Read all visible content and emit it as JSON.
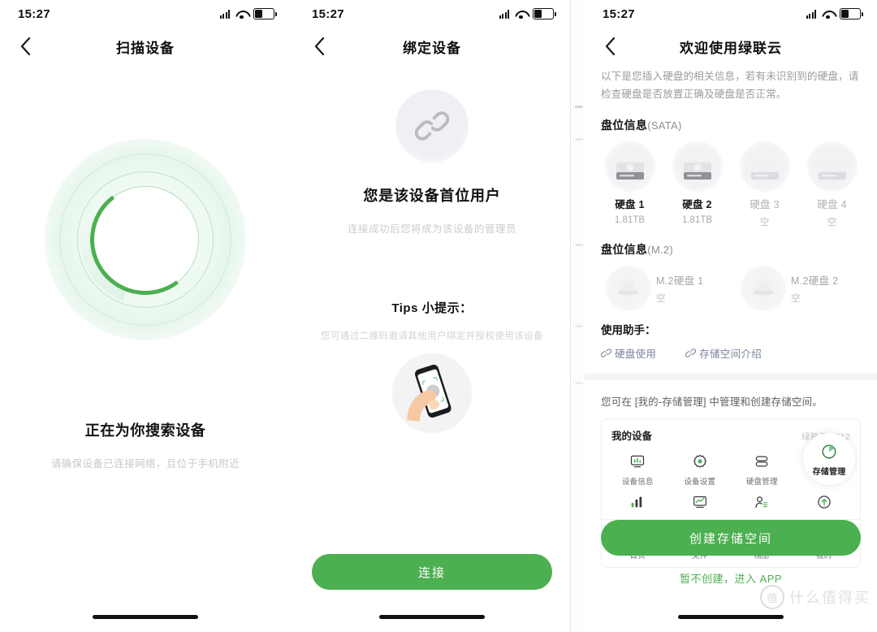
{
  "status_bar": {
    "time": "15:27"
  },
  "panel_scan": {
    "nav_title": "扫描设备",
    "title": "正在为你搜索设备",
    "subtitle": "请确保设备已连接网络，且位于手机附近"
  },
  "panel_bind": {
    "nav_title": "绑定设备",
    "title": "您是该设备首位用户",
    "subtitle": "连接成功后您将成为该设备的管理员",
    "tips_title": "Tips 小提示：",
    "tips_text": "您可通过二维码邀请其他用户绑定并授权使用该设备",
    "connect_button": "连接"
  },
  "panel_welcome": {
    "nav_title": "欢迎使用绿联云",
    "description": "以下是您插入硬盘的相关信息，若有未识别到的硬盘，请检查硬盘是否放置正确及硬盘是否正常。",
    "sata_section": {
      "label": "盘位信息",
      "suffix": "(SATA)"
    },
    "sata_bays": [
      {
        "name": "硬盘 1",
        "capacity": "1.81TB",
        "present": true
      },
      {
        "name": "硬盘 2",
        "capacity": "1.81TB",
        "present": true
      },
      {
        "name": "硬盘 3",
        "capacity": "空",
        "present": false
      },
      {
        "name": "硬盘 4",
        "capacity": "空",
        "present": false
      }
    ],
    "m2_section": {
      "label": "盘位信息",
      "suffix": "(M.2)"
    },
    "m2_bays": [
      {
        "name": "M.2硬盘 1",
        "capacity": "空"
      },
      {
        "name": "M.2硬盘 2",
        "capacity": "空"
      }
    ],
    "helper_title": "使用助手：",
    "helper_links": [
      {
        "label": "硬盘使用"
      },
      {
        "label": "存储空间介绍"
      }
    ],
    "note": "您可在 [我的-存储管理] 中管理和创建存储空间。",
    "preview": {
      "title": "我的设备",
      "model": "绿联云-4912",
      "row1": [
        {
          "label": "设备信息",
          "icon": "chart-monitor-icon"
        },
        {
          "label": "设备设置",
          "icon": "gear-icon"
        },
        {
          "label": "硬盘管理",
          "icon": "disk-stack-icon"
        },
        {
          "label": "存储管理",
          "icon": "pie-chart-icon",
          "highlighted": true
        }
      ],
      "row2": [
        {
          "icon": "bar-chart-icon"
        },
        {
          "icon": "line-monitor-icon"
        },
        {
          "icon": "user-list-icon"
        },
        {
          "icon": "upload-circle-icon"
        }
      ],
      "nav": [
        {
          "label": "首页",
          "icon": "home-icon"
        },
        {
          "label": "文件",
          "icon": "folder-icon"
        },
        {
          "label": "相册",
          "icon": "photo-icon"
        },
        {
          "label": "我的",
          "icon": "profile-icon",
          "active": true
        }
      ]
    },
    "primary_button": "创建存储空间",
    "secondary_link": "暂不创建，进入 APP"
  },
  "watermark": {
    "badge": "值",
    "text": "什么值得买"
  },
  "colors": {
    "accent": "#4caf50",
    "link": "#7b8499",
    "muted": "#c9c9cc"
  }
}
